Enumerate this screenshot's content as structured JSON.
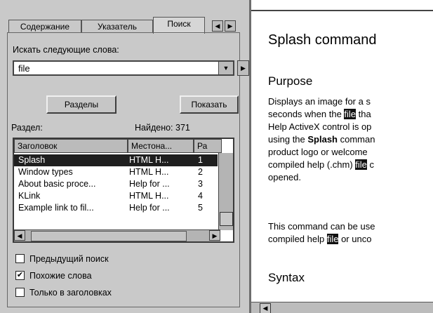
{
  "tabs": [
    {
      "label": "Содержание"
    },
    {
      "label": "Указатель"
    },
    {
      "label": "Поиск"
    }
  ],
  "search": {
    "prompt": "Искать следующие слова:",
    "value": "file"
  },
  "buttons": {
    "sections": "Разделы",
    "show": "Показать"
  },
  "results": {
    "label": "Раздел:",
    "found": "Найдено: 371",
    "columns": [
      "Заголовок",
      "Местона...",
      "Ра"
    ],
    "rows": [
      {
        "title": "Splash",
        "location": "HTML H...",
        "rank": "1",
        "selected": true
      },
      {
        "title": "Window types",
        "location": "HTML H...",
        "rank": "2",
        "selected": false
      },
      {
        "title": "About basic proce...",
        "location": "Help for ...",
        "rank": "3",
        "selected": false
      },
      {
        "title": "KLink",
        "location": "HTML H...",
        "rank": "4",
        "selected": false
      },
      {
        "title": "Example link to fil...",
        "location": "Help for ...",
        "rank": "5",
        "selected": false
      }
    ]
  },
  "options": [
    {
      "label": "Предыдущий поиск",
      "checked": false
    },
    {
      "label": "Похожие слова",
      "checked": true
    },
    {
      "label": "Только в заголовках",
      "checked": false
    }
  ],
  "article": {
    "title": "Splash command",
    "purpose_heading": "Purpose",
    "purpose_lines": [
      [
        "Displays an image for a s"
      ],
      [
        "seconds when the ",
        {
          "hl": "file"
        },
        " tha"
      ],
      [
        "Help ActiveX control is op"
      ],
      [
        "using the ",
        {
          "b": "Splash"
        },
        " comman"
      ],
      [
        "product logo or welcome"
      ],
      [
        "compiled help (.chm) ",
        {
          "hl": "file"
        },
        " c"
      ],
      [
        "opened."
      ]
    ],
    "usage_lines": [
      [
        "This command can be use"
      ],
      [
        "compiled help ",
        {
          "hl": "file"
        },
        " or unco"
      ]
    ],
    "syntax_heading": "Syntax"
  }
}
